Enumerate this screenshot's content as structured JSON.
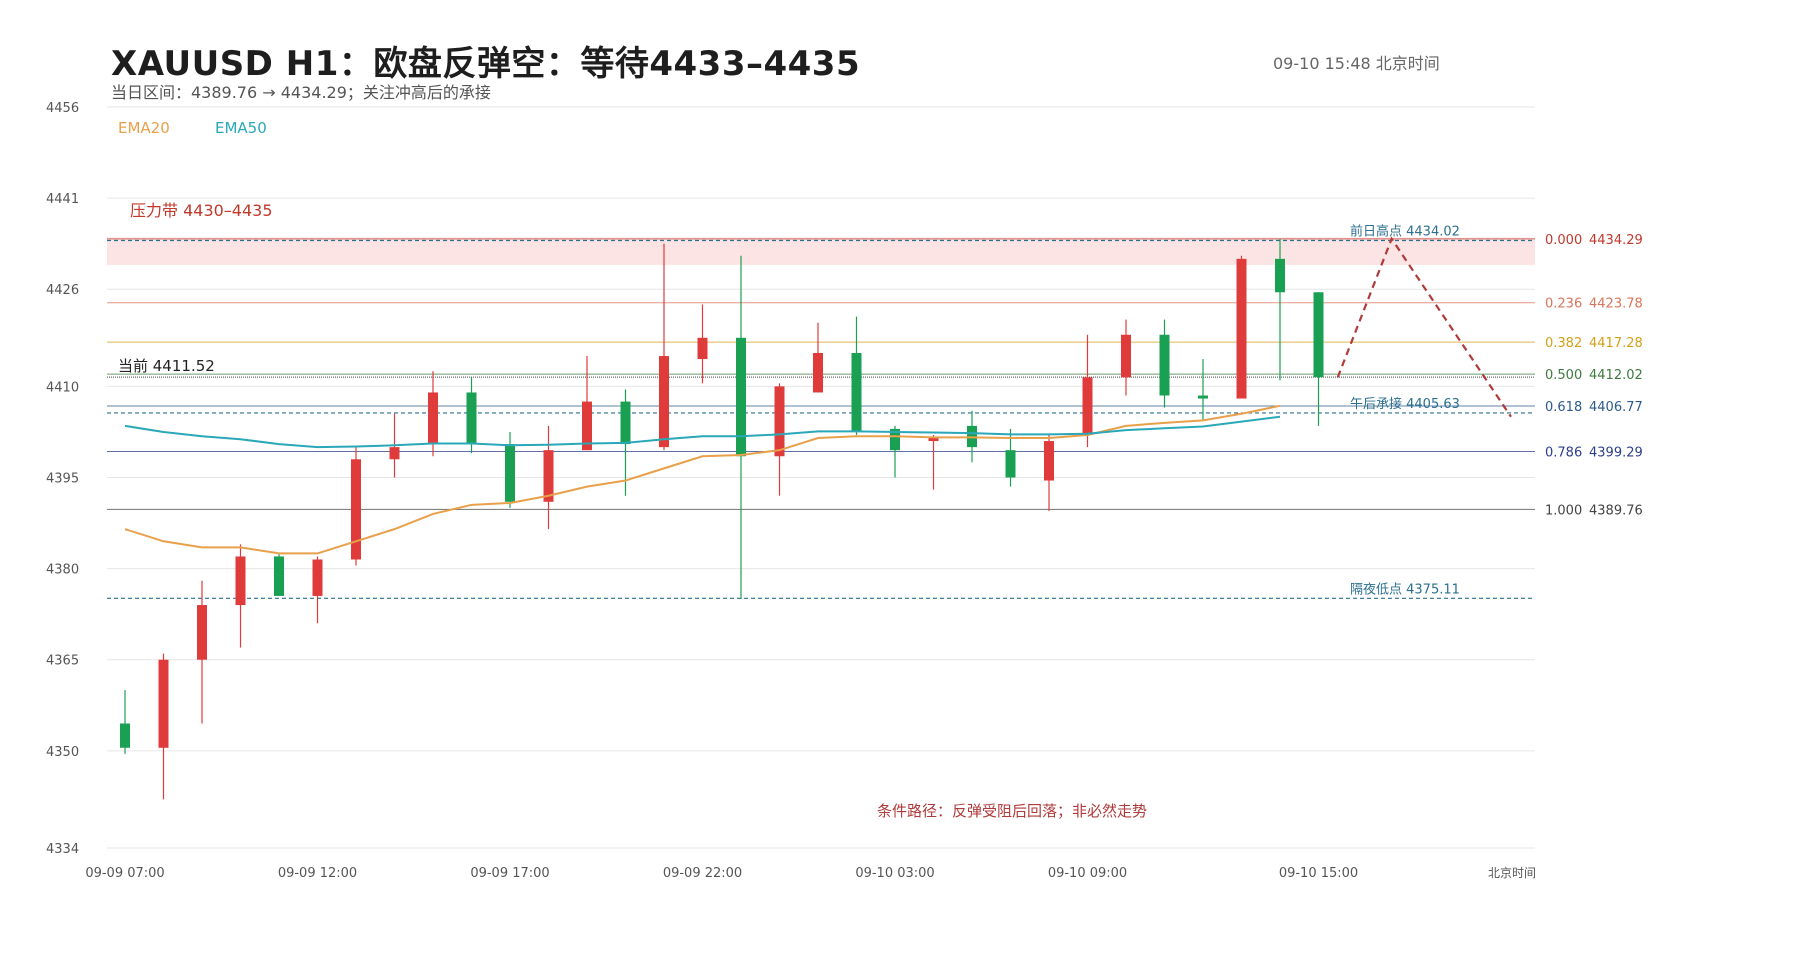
{
  "header": {
    "title": "XAUUSD  H1：欧盘反弹空：等待4433–4435",
    "subtitle": "当日区间：4389.76 → 4434.29；关注冲高后的承接",
    "timestamp": "09-10  15:48 北京时间"
  },
  "colors": {
    "up": "#1aa053",
    "down": "#e03b3b",
    "ema20": "#e8a04a",
    "ema50": "#2aa8b8",
    "zone_fill": "#fce4e4",
    "zone_text": "#c0392b",
    "projection": "#b03a3a",
    "grid": "#e6e6e6",
    "axis_text": "#555555"
  },
  "chart_data": {
    "type": "candlestick",
    "ylim": [
      4334,
      4456
    ],
    "y_ticks": [
      4456,
      4441,
      4426,
      4410,
      4395,
      4380,
      4365,
      4350,
      4334
    ],
    "x_tick_labels": [
      "09-09 07:00",
      "09-09 12:00",
      "09-09 17:00",
      "09-09 22:00",
      "09-10 03:00",
      "09-10 09:00",
      "09-10 15:00"
    ],
    "x_tick_index": [
      0,
      5,
      10,
      15,
      20,
      25,
      31
    ],
    "x_axis_unit_label": "北京时间",
    "legend": [
      {
        "name": "EMA20",
        "color_key": "ema20"
      },
      {
        "name": "EMA50",
        "color_key": "ema50"
      }
    ],
    "candles": [
      {
        "t": "09-09 07:00",
        "o": 4350.5,
        "h": 4360.0,
        "l": 4349.5,
        "c": 4354.5
      },
      {
        "t": "09-09 08:00",
        "o": 4365.0,
        "h": 4366.0,
        "l": 4342.0,
        "c": 4350.5
      },
      {
        "t": "09-09 09:00",
        "o": 4374.0,
        "h": 4378.0,
        "l": 4354.5,
        "c": 4365.0
      },
      {
        "t": "09-09 10:00",
        "o": 4382.0,
        "h": 4384.0,
        "l": 4367.0,
        "c": 4374.0
      },
      {
        "t": "09-09 11:00",
        "o": 4375.5,
        "h": 4382.5,
        "l": 4375.5,
        "c": 4382.0
      },
      {
        "t": "09-09 12:00",
        "o": 4381.5,
        "h": 4382.0,
        "l": 4371.0,
        "c": 4375.5
      },
      {
        "t": "09-09 13:00",
        "o": 4398.0,
        "h": 4400.0,
        "l": 4380.5,
        "c": 4381.5
      },
      {
        "t": "09-09 14:00",
        "o": 4400.0,
        "h": 4405.5,
        "l": 4395.0,
        "c": 4398.0
      },
      {
        "t": "09-09 15:00",
        "o": 4409.0,
        "h": 4412.5,
        "l": 4398.5,
        "c": 4400.5
      },
      {
        "t": "09-09 16:00",
        "o": 4400.5,
        "h": 4411.5,
        "l": 4399.0,
        "c": 4409.0
      },
      {
        "t": "09-09 17:00",
        "o": 4391.0,
        "h": 4402.5,
        "l": 4390.0,
        "c": 4400.5
      },
      {
        "t": "09-09 18:00",
        "o": 4399.5,
        "h": 4403.5,
        "l": 4386.5,
        "c": 4391.0
      },
      {
        "t": "09-09 19:00",
        "o": 4407.5,
        "h": 4415.0,
        "l": 4399.5,
        "c": 4399.5
      },
      {
        "t": "09-09 20:00",
        "o": 4400.5,
        "h": 4409.5,
        "l": 4392.0,
        "c": 4407.5
      },
      {
        "t": "09-09 21:00",
        "o": 4415.0,
        "h": 4433.5,
        "l": 4399.5,
        "c": 4400.0
      },
      {
        "t": "09-09 22:00",
        "o": 4418.0,
        "h": 4423.5,
        "l": 4410.5,
        "c": 4414.5
      },
      {
        "t": "09-09 23:00",
        "o": 4398.5,
        "h": 4431.5,
        "l": 4375.0,
        "c": 4418.0
      },
      {
        "t": "09-10 00:00",
        "o": 4410.0,
        "h": 4410.5,
        "l": 4392.0,
        "c": 4398.5
      },
      {
        "t": "09-10 01:00",
        "o": 4415.5,
        "h": 4420.5,
        "l": 4409.5,
        "c": 4409.0
      },
      {
        "t": "09-10 02:00",
        "o": 4402.5,
        "h": 4421.5,
        "l": 4402.0,
        "c": 4415.5
      },
      {
        "t": "09-10 03:00",
        "o": 4399.5,
        "h": 4403.5,
        "l": 4395.0,
        "c": 4403.0
      },
      {
        "t": "09-10 04:00",
        "o": 4401.5,
        "h": 4402.0,
        "l": 4393.0,
        "c": 4401.0
      },
      {
        "t": "09-10 05:00",
        "o": 4400.0,
        "h": 4406.0,
        "l": 4397.5,
        "c": 4403.5
      },
      {
        "t": "09-10 06:00",
        "o": 4395.0,
        "h": 4403.0,
        "l": 4393.5,
        "c": 4399.5
      },
      {
        "t": "09-10 07:00",
        "o": 4401.0,
        "h": 4402.0,
        "l": 4389.5,
        "c": 4394.5
      },
      {
        "t": "09-10 08:00",
        "o": 4411.5,
        "h": 4418.5,
        "l": 4400.0,
        "c": 4402.0
      },
      {
        "t": "09-10 09:00",
        "o": 4418.5,
        "h": 4421.0,
        "l": 4408.5,
        "c": 4411.5
      },
      {
        "t": "09-10 10:00",
        "o": 4408.5,
        "h": 4421.0,
        "l": 4406.5,
        "c": 4418.5
      },
      {
        "t": "09-10 11:00",
        "o": 4408.0,
        "h": 4414.5,
        "l": 4404.5,
        "c": 4408.5
      },
      {
        "t": "09-10 12:00",
        "o": 4431.0,
        "h": 4431.5,
        "l": 4408.0,
        "c": 4408.0
      },
      {
        "t": "09-10 13:00",
        "o": 4425.5,
        "h": 4434.29,
        "l": 4411.0,
        "c": 4431.0
      },
      {
        "t": "09-10 14:00",
        "o": 4411.52,
        "h": 4425.5,
        "l": 4403.5,
        "c": 4425.5
      }
    ],
    "ema20": [
      4386.5,
      4384.5,
      4383.5,
      4383.5,
      4382.5,
      4382.5,
      4384.5,
      4386.5,
      4389.0,
      4390.5,
      4390.8,
      4392.0,
      4393.5,
      4394.5,
      4396.5,
      4398.5,
      4398.7,
      4399.5,
      4401.5,
      4401.8,
      4401.8,
      4401.6,
      4401.6,
      4401.5,
      4401.5,
      4402.0,
      4403.5,
      4404.0,
      4404.4,
      4405.5,
      4406.8
    ],
    "ema50": [
      4403.5,
      4402.5,
      4401.8,
      4401.3,
      4400.5,
      4400.0,
      4400.1,
      4400.3,
      4400.6,
      4400.6,
      4400.3,
      4400.4,
      4400.6,
      4400.7,
      4401.3,
      4401.8,
      4401.8,
      4402.1,
      4402.6,
      4402.6,
      4402.5,
      4402.4,
      4402.3,
      4402.1,
      4402.1,
      4402.2,
      4402.8,
      4403.1,
      4403.4,
      4404.2,
      4405.0
    ],
    "current": {
      "label": "当前 4411.52",
      "value": 4411.52
    },
    "resistance_zone": {
      "label": "压力带  4430–4435",
      "from": 4430,
      "to": 4434.5
    },
    "levels": [
      {
        "label": "前日高点 4434.02",
        "value": 4434.02,
        "color": "#2c6f8f"
      },
      {
        "label": "午后承接 4405.63",
        "value": 4405.63,
        "color": "#2c6f8f"
      },
      {
        "label": "隔夜低点 4375.11",
        "value": 4375.11,
        "color": "#2c6f8f"
      }
    ],
    "fibonacci": [
      {
        "ratio": "0.000",
        "value": 4434.29,
        "price_label": "4434.29",
        "color": "#c0392b"
      },
      {
        "ratio": "0.236",
        "value": 4423.78,
        "price_label": "4423.78",
        "color": "#d9755a"
      },
      {
        "ratio": "0.382",
        "value": 4417.28,
        "price_label": "4417.28",
        "color": "#d4a017"
      },
      {
        "ratio": "0.500",
        "value": 4412.02,
        "price_label": "4412.02",
        "color": "#3f7a3f"
      },
      {
        "ratio": "0.618",
        "value": 4406.77,
        "price_label": "4406.77",
        "color": "#2c5a8a"
      },
      {
        "ratio": "0.786",
        "value": 4399.29,
        "price_label": "4399.29",
        "color": "#2c3f8a"
      },
      {
        "ratio": "1.000",
        "value": 4389.76,
        "price_label": "4389.76",
        "color": "#444444"
      }
    ],
    "projection": {
      "path_values": [
        4411.5,
        4434.3,
        4405.0
      ],
      "path_index": [
        32.0,
        33.4,
        36.5
      ],
      "note": "条件路径：反弹受阻后回落；非必然走势"
    }
  }
}
